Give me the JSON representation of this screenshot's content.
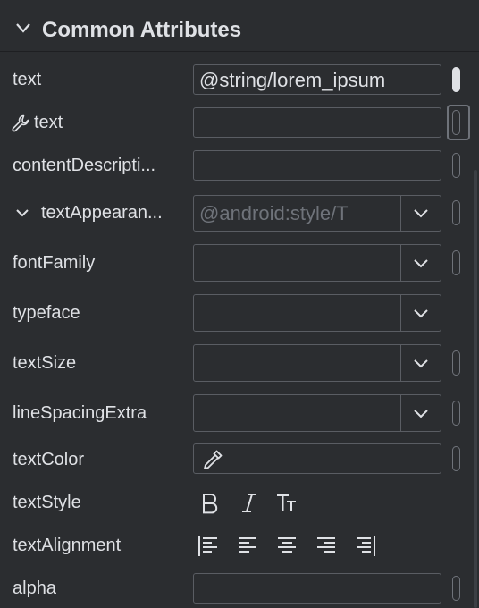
{
  "section": {
    "title": "Common Attributes",
    "expanded": true
  },
  "rows": [
    {
      "label": "text",
      "value": "@string/lorem_ipsum"
    },
    {
      "label": "text",
      "icon": "wrench-icon",
      "value": ""
    },
    {
      "label": "contentDescripti...",
      "value": ""
    },
    {
      "label": "textAppearan...",
      "value": "@android:style/T",
      "expandable": true
    },
    {
      "label": "fontFamily",
      "value": ""
    },
    {
      "label": "typeface",
      "value": ""
    },
    {
      "label": "textSize",
      "value": ""
    },
    {
      "label": "lineSpacingExtra",
      "value": ""
    },
    {
      "label": "textColor",
      "icon": "eyedropper-icon",
      "value": ""
    },
    {
      "label": "textStyle",
      "buttons": [
        "bold-icon",
        "italic-icon",
        "all-caps-icon"
      ]
    },
    {
      "label": "textAlignment",
      "buttons": [
        "align-start-icon",
        "align-left-icon",
        "align-center-icon",
        "align-right-icon",
        "align-end-icon"
      ]
    },
    {
      "label": "alpha",
      "value": ""
    }
  ],
  "colors": {
    "background": "#2b2d30",
    "border": "#5a5d63",
    "text": "#dfe1e5",
    "hint": "#6f737a"
  }
}
